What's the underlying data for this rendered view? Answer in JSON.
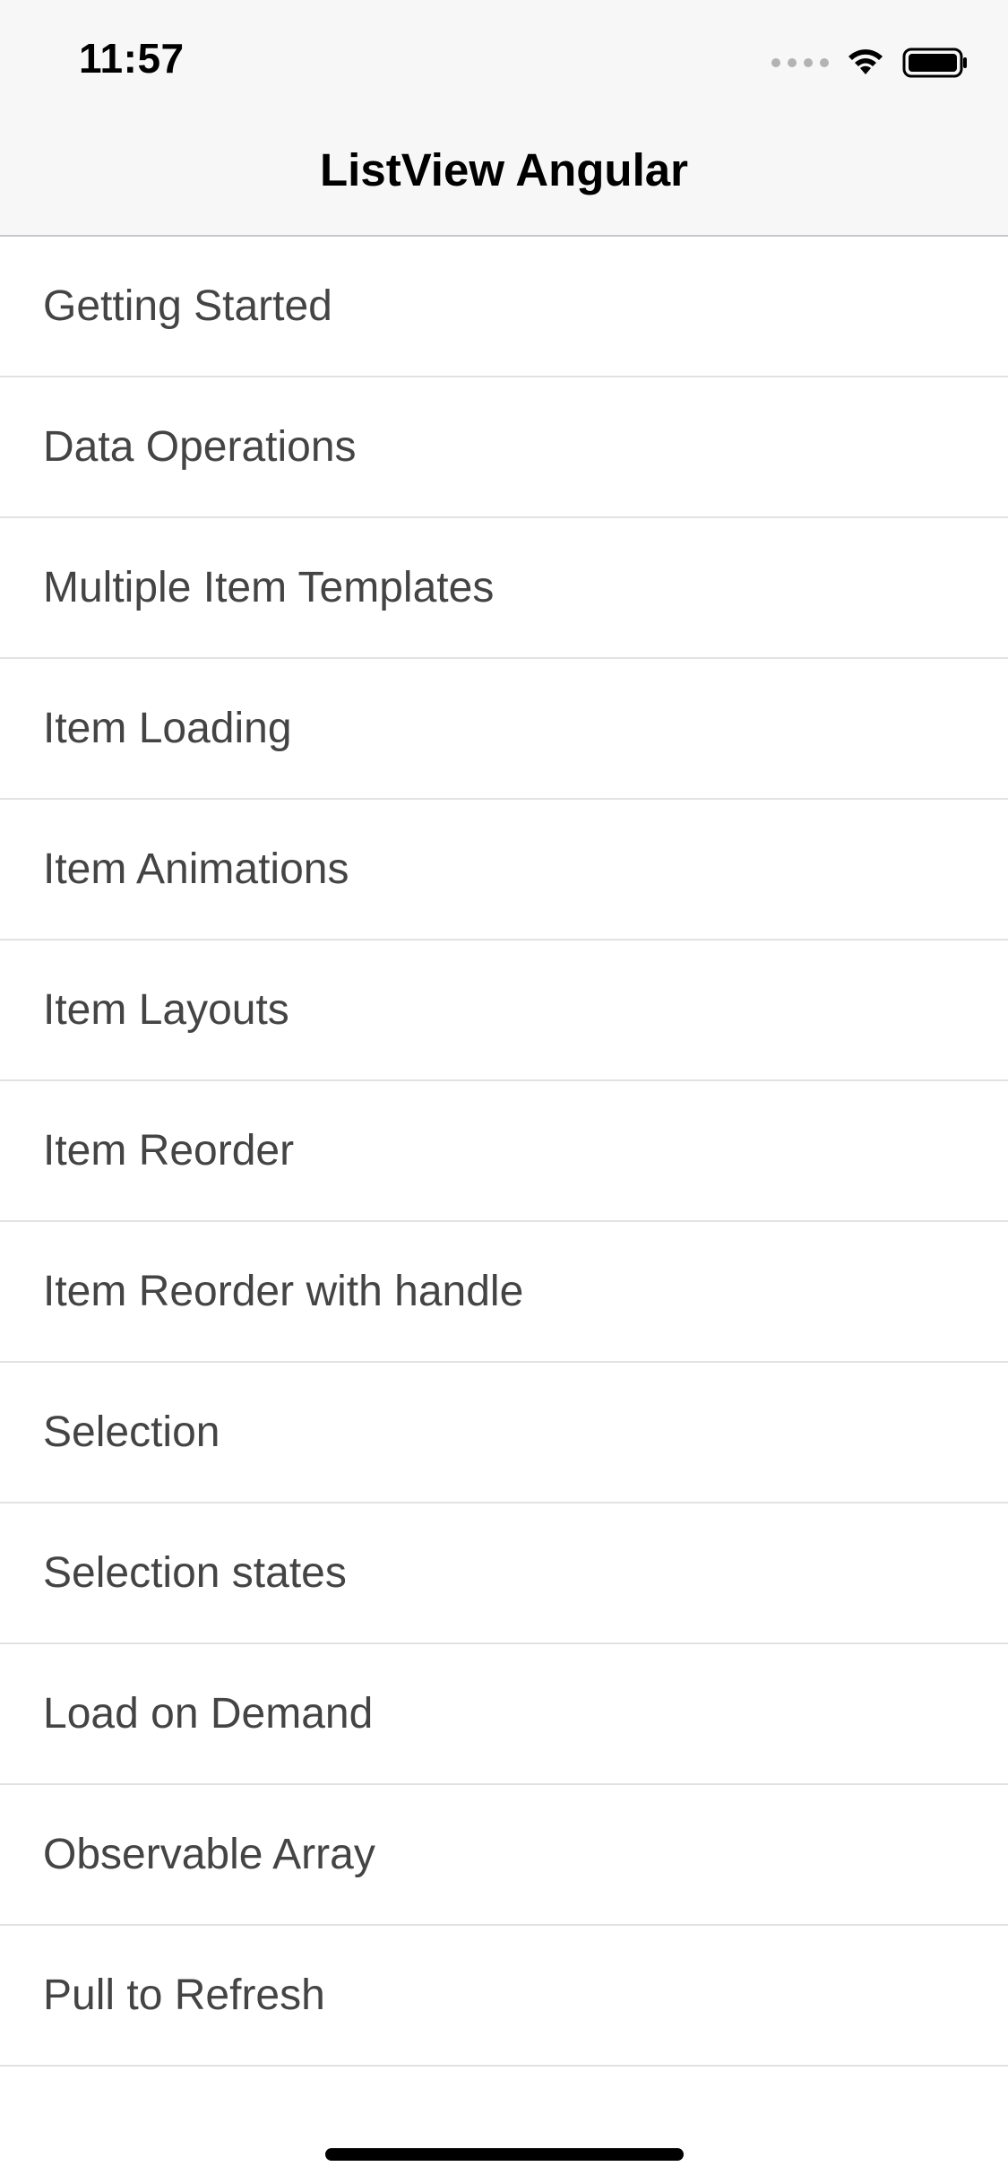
{
  "status_bar": {
    "time": "11:57"
  },
  "nav": {
    "title": "ListView Angular"
  },
  "list": {
    "items": [
      {
        "label": "Getting Started"
      },
      {
        "label": "Data Operations"
      },
      {
        "label": "Multiple Item Templates"
      },
      {
        "label": "Item Loading"
      },
      {
        "label": "Item Animations"
      },
      {
        "label": "Item Layouts"
      },
      {
        "label": "Item Reorder"
      },
      {
        "label": "Item Reorder with handle"
      },
      {
        "label": "Selection"
      },
      {
        "label": "Selection states"
      },
      {
        "label": "Load on Demand"
      },
      {
        "label": "Observable Array"
      },
      {
        "label": "Pull to Refresh"
      }
    ]
  },
  "icons": [
    "signal-dots-icon",
    "wifi-icon",
    "battery-icon"
  ]
}
